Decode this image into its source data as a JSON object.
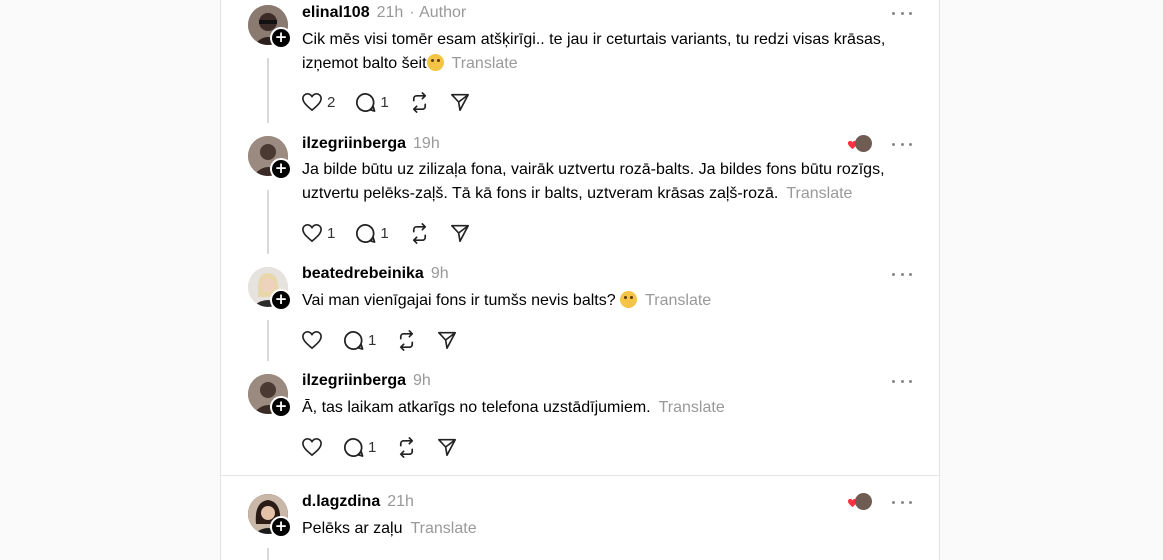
{
  "thread": {
    "posts": [
      {
        "username": "elinal108",
        "time": "21h",
        "author_tag": "Author",
        "text": "Cik mēs visi tomēr esam atšķirīgi.. te jau ir ceturtais variants, tu redzi visas krāsas, izņemot balto šeit",
        "translate": "Translate",
        "likes": "2",
        "replies": "1",
        "liked_by_author": false
      },
      {
        "username": "ilzegriinberga",
        "time": "19h",
        "text": "Ja bilde būtu uz zilizaļa fona, vairāk uztvertu rozā-balts. Ja bildes fons būtu rozīgs, uztvertu pelēks-zaļš. Tā kā fons ir balts, uztveram krāsas zaļš-rozā.",
        "translate": "Translate",
        "likes": "1",
        "replies": "1",
        "liked_by_author": true
      },
      {
        "username": "beatedrebeinika",
        "time": "9h",
        "text": "Vai man vienīgajai fons ir tumšs nevis balts?",
        "translate": "Translate",
        "likes": "",
        "replies": "1",
        "liked_by_author": false
      },
      {
        "username": "ilzegriinberga",
        "time": "9h",
        "text": "Ā, tas laikam atkarīgs no telefona uzstādījumiem.",
        "translate": "Translate",
        "likes": "",
        "replies": "1",
        "liked_by_author": false
      },
      {
        "username": "d.lagzdina",
        "time": "21h",
        "text": "Pelēks ar zaļu",
        "translate": "Translate",
        "likes": "",
        "replies": "",
        "liked_by_author": true
      }
    ]
  },
  "icons": {
    "like": "heart-icon",
    "reply": "comment-icon",
    "repost": "repost-icon",
    "share": "send-icon",
    "more": "more-horizontal-icon",
    "follow": "plus-icon"
  },
  "colors": {
    "heart_liked": "#ff3040",
    "muted_text": "#999999",
    "thread_line": "#d9d9d9"
  }
}
